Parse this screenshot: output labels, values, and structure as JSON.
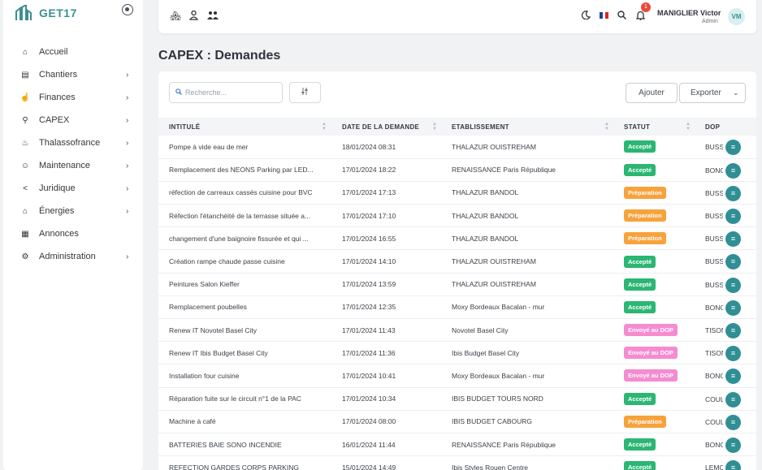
{
  "app": {
    "name": "GET17"
  },
  "sidebar": {
    "items": [
      {
        "label": "Accueil",
        "icon": "home-icon",
        "chevron": false
      },
      {
        "label": "Chantiers",
        "icon": "building-doc-icon",
        "chevron": true
      },
      {
        "label": "Finances",
        "icon": "chart-hand-icon",
        "chevron": true
      },
      {
        "label": "CAPEX",
        "icon": "capex-icon",
        "chevron": true
      },
      {
        "label": "Thalassofrance",
        "icon": "spa-icon",
        "chevron": true
      },
      {
        "label": "Maintenance",
        "icon": "worker-icon",
        "chevron": true
      },
      {
        "label": "Juridique",
        "icon": "share-icon",
        "chevron": true
      },
      {
        "label": "Énergies",
        "icon": "house-energy-icon",
        "chevron": true
      },
      {
        "label": "Annonces",
        "icon": "store-icon",
        "chevron": false
      },
      {
        "label": "Administration",
        "icon": "gear-icon",
        "chevron": true
      }
    ]
  },
  "header": {
    "notification_count": "1",
    "user_name": "MANIGLIER Victor",
    "user_role": "Admin",
    "avatar_initials": "VM",
    "flag_colors": [
      "#1f3fa0",
      "#ffffff",
      "#d72828"
    ]
  },
  "page": {
    "title": "CAPEX : Demandes"
  },
  "toolbar": {
    "search_placeholder": "Recherche...",
    "add_label": "Ajouter",
    "export_label": "Exporter"
  },
  "table": {
    "columns": [
      "INTITULÉ",
      "DATE DE LA DEMANDE",
      "ETABLISSEMENT",
      "STATUT",
      "DOP"
    ],
    "status_colors": {
      "Accepté": "#2bb673",
      "Préparation": "#f7a23b",
      "Envoyé au DOP": "#f58bd0"
    },
    "rows": [
      {
        "title": "Pompe à vide eau de mer",
        "date": "18/01/2024 08:31",
        "establishment": "THALAZUR OUISTREHAM",
        "status": "Accepté",
        "dop": "BUSS"
      },
      {
        "title": "Remplacement des NEONS Parking par LED...",
        "date": "17/01/2024 18:22",
        "establishment": "RENAISSANCE Paris République",
        "status": "Accepté",
        "dop": "BONG"
      },
      {
        "title": "réfection de carreaux cassés cuisine pour BVC",
        "date": "17/01/2024 17:13",
        "establishment": "THALAZUR BANDOL",
        "status": "Préparation",
        "dop": "BUSS"
      },
      {
        "title": "Réfection l'étanchéité de la terrasse située a...",
        "date": "17/01/2024 17:10",
        "establishment": "THALAZUR BANDOL",
        "status": "Préparation",
        "dop": "BUSS"
      },
      {
        "title": "changement d'une baignoire fissurée et qui ...",
        "date": "17/01/2024 16:55",
        "establishment": "THALAZUR BANDOL",
        "status": "Préparation",
        "dop": "BUSS"
      },
      {
        "title": "Création rampe chaude passe cuisine",
        "date": "17/01/2024 14:10",
        "establishment": "THALAZUR OUISTREHAM",
        "status": "Accepté",
        "dop": "BUSS"
      },
      {
        "title": "Peintures Salon Kieffer",
        "date": "17/01/2024 13:59",
        "establishment": "THALAZUR OUISTREHAM",
        "status": "Accepté",
        "dop": "BUSS"
      },
      {
        "title": "Remplacement poubelles",
        "date": "17/01/2024 12:35",
        "establishment": "Moxy Bordeaux Bacalan - mur",
        "status": "Accepté",
        "dop": "BONG"
      },
      {
        "title": "Renew IT Novotel Basel City",
        "date": "17/01/2024 11:43",
        "establishment": "Novotel Basel City",
        "status": "Envoyé au DOP",
        "dop": "TISON"
      },
      {
        "title": "Renew IT Ibis Budget Basel City",
        "date": "17/01/2024 11:36",
        "establishment": "Ibis Budget Basel City",
        "status": "Envoyé au DOP",
        "dop": "TISON"
      },
      {
        "title": "Installation four cuisine",
        "date": "17/01/2024 10:41",
        "establishment": "Moxy Bordeaux Bacalan - mur",
        "status": "Envoyé au DOP",
        "dop": "BONG"
      },
      {
        "title": "Réparation fuite sur le circuit n°1 de la PAC",
        "date": "17/01/2024 10:34",
        "establishment": "IBIS BUDGET TOURS NORD",
        "status": "Accepté",
        "dop": "COUL"
      },
      {
        "title": "Machine à café",
        "date": "17/01/2024 08:00",
        "establishment": "IBIS BUDGET CABOURG",
        "status": "Préparation",
        "dop": "COUL"
      },
      {
        "title": "BATTERIES BAIE SONO INCENDIE",
        "date": "16/01/2024 11:44",
        "establishment": "RENAISSANCE Paris République",
        "status": "Accepté",
        "dop": "BONG"
      },
      {
        "title": "REFECTION GARDES CORPS PARKING",
        "date": "15/01/2024 14:49",
        "establishment": "Ibis Styles Rouen Centre",
        "status": "Accepté",
        "dop": "LEMO"
      }
    ]
  }
}
